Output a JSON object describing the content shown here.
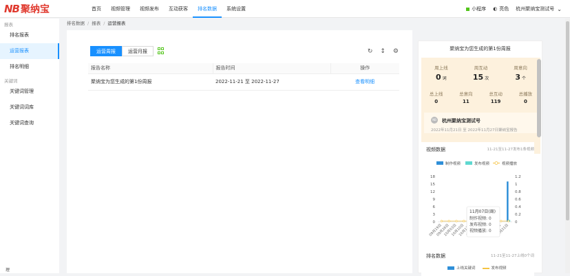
{
  "logo": {
    "mark": "NB",
    "name": "聚纳宝"
  },
  "nav": {
    "items": [
      "首页",
      "视频管理",
      "视频发布",
      "互动获客",
      "排名数据",
      "系统设置"
    ],
    "active": "排名数据"
  },
  "topright": {
    "mini_program": "小程序",
    "theme": "亮色",
    "account": "杭州聚纳宝测试号"
  },
  "sidebar": {
    "group1": "报表",
    "items1": [
      "排名报表",
      "运营报表",
      "排名明细"
    ],
    "group2": "关键词",
    "items2": [
      "关键词管理",
      "关键词词库",
      "关键词查询"
    ],
    "bottom": "理"
  },
  "breadcrumb": {
    "a": "排名数据",
    "b": "报表",
    "c": "运营报表"
  },
  "tabs": {
    "weekly": "运营周报",
    "monthly": "运营月报"
  },
  "table": {
    "headers": [
      "报告名称",
      "报告时间",
      "操作"
    ],
    "rows": [
      {
        "name": "聚纳宝为您生成的第1份周报",
        "time": "2022-11-21 至 2022-11-27",
        "action": "查看明细"
      }
    ]
  },
  "panel": {
    "title": "聚纳宝为您生成的第1份周报",
    "week_stats": [
      {
        "label": "周上线",
        "value": "0",
        "unit": "词"
      },
      {
        "label": "周互动",
        "value": "15",
        "unit": "次"
      },
      {
        "label": "周意向",
        "value": "3",
        "unit": "个"
      }
    ],
    "total_stats": [
      {
        "label": "总上线",
        "value": "0"
      },
      {
        "label": "总意向",
        "value": "11"
      },
      {
        "label": "总互动",
        "value": "119"
      },
      {
        "label": "总播放",
        "value": "0"
      }
    ],
    "account_avatar": "NB",
    "account_name": "杭州聚纳宝测试号",
    "account_date": "2022年11月21日 至 2022年11月27日聚纳宝报告",
    "video_title": "视频数据",
    "video_range": "11-21至11-27发布1条视频",
    "legend": [
      "制作视频",
      "发布视频",
      "视频播放"
    ],
    "tooltip": {
      "date": "11月07日(周)",
      "lines": [
        "制作视频: 0",
        "发布视频: 0",
        "视频播放: 0"
      ]
    },
    "rank_title": "排名数据",
    "rank_range": "11-21至11-27上线0个词",
    "rank_legend": [
      "上线关键词",
      "发布视频"
    ]
  },
  "chart_data": {
    "type": "bar",
    "title": "视频数据",
    "categories": [
      "09月19日",
      "09月26日",
      "10月03日",
      "10月10日",
      "10月17日",
      "10月24日",
      "10月31日",
      "11月07日",
      "11月14日",
      "11月21日"
    ],
    "y_left_ticks": [
      "18",
      "15",
      "12",
      "9",
      "6",
      "3",
      "0"
    ],
    "y_right_ticks": [
      "1.2",
      "1",
      "0.8",
      "0.6",
      "0.4",
      "0.2",
      "0"
    ],
    "ylim_left": [
      0,
      18
    ],
    "ylim_right": [
      0,
      1.2
    ],
    "series": [
      {
        "name": "制作视频",
        "values": [
          0,
          0,
          0,
          0,
          0,
          0,
          0,
          0,
          0,
          16
        ],
        "color": "#2f8fd8"
      },
      {
        "name": "发布视频",
        "values": [
          0,
          0,
          0,
          0,
          0,
          0,
          0,
          0,
          0,
          1
        ],
        "color": "#5fd8d0"
      },
      {
        "name": "视频播放",
        "values": [
          0,
          0,
          0,
          0,
          0,
          0,
          0,
          0,
          0,
          0
        ],
        "color": "#f5c342"
      }
    ]
  }
}
